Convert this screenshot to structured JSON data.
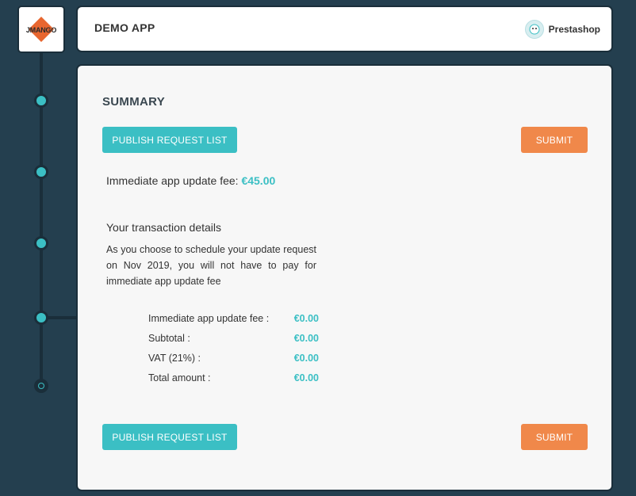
{
  "logo": {
    "text": "JMANGO"
  },
  "header": {
    "app_title": "DEMO APP",
    "platform": {
      "label": "Prestashop",
      "icon": "prestashop-icon"
    }
  },
  "summary": {
    "title": "SUMMARY",
    "publish_button_label": "PUBLISH REQUEST LIST",
    "submit_button_label": "SUBMIT",
    "immediate_fee_label": "Immediate app update fee:",
    "immediate_fee_value": "€45.00",
    "transaction_title": "Your transaction details",
    "transaction_note": "As you choose to schedule your update request on Nov 2019, you will not have to pay for immediate app update fee",
    "rows": [
      {
        "label": "Immediate app update fee :",
        "value": "€0.00"
      },
      {
        "label": "Subtotal :",
        "value": "€0.00"
      },
      {
        "label": "VAT (21%) :",
        "value": "€0.00"
      },
      {
        "label": "Total amount :",
        "value": "€0.00"
      }
    ]
  },
  "colors": {
    "background": "#243f4f",
    "accent_teal": "#3bbfc4",
    "accent_orange": "#f0884a",
    "card": "#f7f7f7"
  }
}
